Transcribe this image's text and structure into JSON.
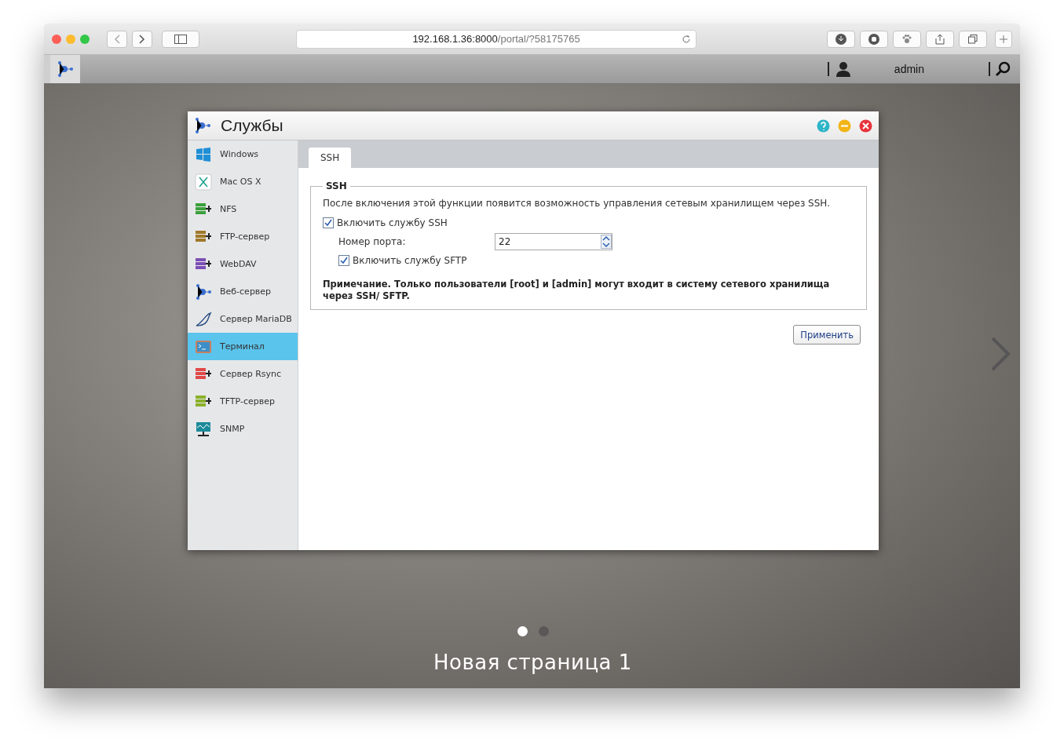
{
  "browser": {
    "url_host": "192.168.1.36:8000",
    "url_path": "/portal/?58175765"
  },
  "topbar": {
    "user": "admin"
  },
  "window": {
    "title": "Службы",
    "sidebar": {
      "items": [
        {
          "label": "Windows",
          "kind": "windows",
          "selected": false
        },
        {
          "label": "Mac OS X",
          "kind": "mac",
          "selected": false
        },
        {
          "label": "NFS",
          "kind": "nfs",
          "selected": false
        },
        {
          "label": "FTP-сервер",
          "kind": "ftp",
          "selected": false
        },
        {
          "label": "WebDAV",
          "kind": "webdav",
          "selected": false
        },
        {
          "label": "Веб-сервер",
          "kind": "web",
          "selected": false
        },
        {
          "label": "Сервер MariaDB",
          "kind": "mariadb",
          "selected": false
        },
        {
          "label": "Терминал",
          "kind": "terminal",
          "selected": true
        },
        {
          "label": "Сервер Rsync",
          "kind": "rsync",
          "selected": false
        },
        {
          "label": "TFTP-сервер",
          "kind": "tftp",
          "selected": false
        },
        {
          "label": "SNMP",
          "kind": "snmp",
          "selected": false
        }
      ]
    },
    "tabs": [
      {
        "label": "SSH",
        "selected": true
      }
    ],
    "group": {
      "legend": "SSH",
      "description": "После включения этой функции появится возможность управления сетевым хранилищем через SSH.",
      "enable_ssh": {
        "label": "Включить службу SSH",
        "checked": true
      },
      "port": {
        "label": "Номер порта:",
        "value": "22"
      },
      "enable_sftp": {
        "label": "Включить службу SFTP",
        "checked": true
      },
      "note": "Примечание. Только пользователи [root] и [admin] могут входит в систему сетевого хранилища через SSH/ SFTP."
    },
    "apply_button": "Применить"
  },
  "pager": {
    "dots": [
      {
        "selected": true
      },
      {
        "selected": false
      }
    ],
    "page_title": "Новая страница 1"
  }
}
